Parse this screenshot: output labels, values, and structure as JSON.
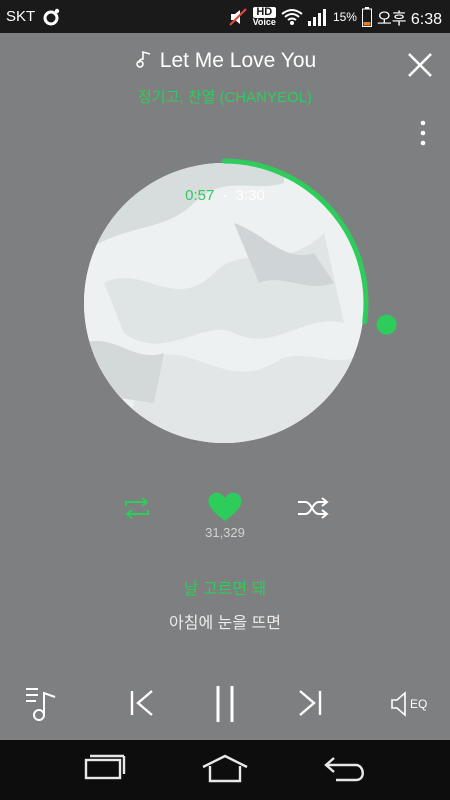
{
  "status": {
    "carrier": "SKT",
    "hd_line1": "HD",
    "hd_line2": "Voice",
    "battery": "15%",
    "time": "오후 6:38"
  },
  "song": {
    "title": "Let Me Love You",
    "artist": "정기고, 찬열 (CHANYEOL)"
  },
  "playback": {
    "current_time": "0:57",
    "separator": "·",
    "total_time": "3:30",
    "progress": 0.271
  },
  "likes": "31,329",
  "lyrics": {
    "current": "날 고르면 돼",
    "next": "아침에 눈을 뜨면"
  },
  "colors": {
    "accent": "#2ecc5a",
    "background": "#7e7f80",
    "system_bar": "#1a1a1a",
    "nav_bar": "#0d0d0d"
  },
  "icons": [
    "smart-guide-icon",
    "mute-icon",
    "wifi-icon",
    "signal-icon",
    "battery-icon",
    "music-note-icon",
    "close-icon",
    "more-options-icon",
    "repeat-icon",
    "heart-icon",
    "shuffle-icon",
    "playlist-icon",
    "previous-icon",
    "pause-icon",
    "next-icon",
    "eq-icon",
    "recent-apps-icon",
    "home-icon",
    "back-icon"
  ],
  "eq_label": "EQ"
}
